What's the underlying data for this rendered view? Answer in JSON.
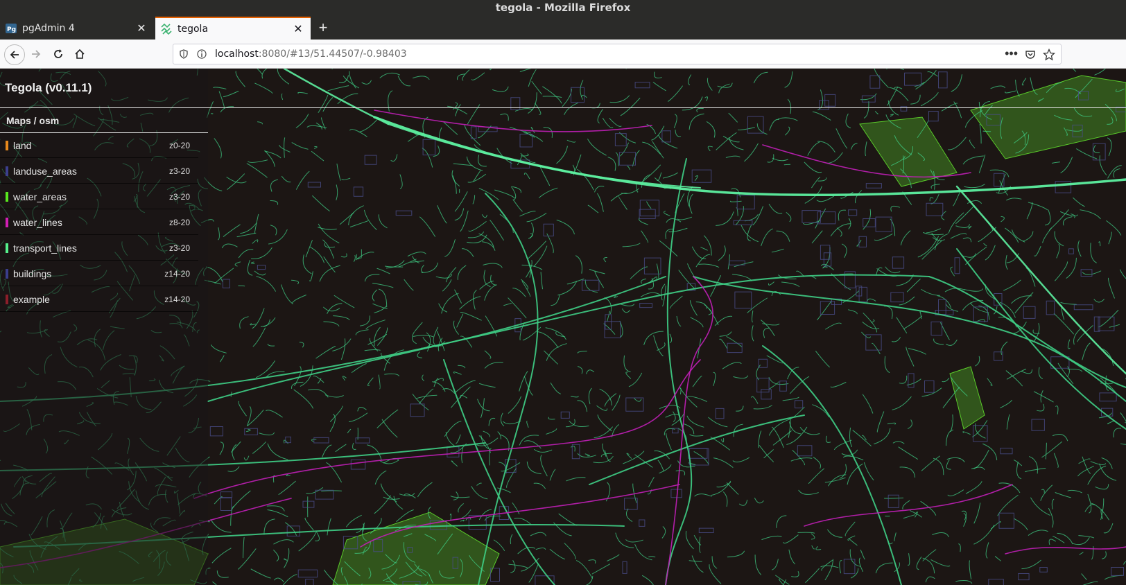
{
  "window": {
    "title": "tegola - Mozilla Firefox"
  },
  "tabs": [
    {
      "label": "pgAdmin 4",
      "icon": "pgadmin-icon",
      "active": false
    },
    {
      "label": "tegola",
      "icon": "tegola-icon",
      "active": true
    }
  ],
  "navbar": {
    "url_host": "localhost",
    "url_rest": ":8080/#13/51.44507/-0.98403"
  },
  "app": {
    "title": "Tegola (v0.11.1)"
  },
  "maps": {
    "title": "Maps / osm",
    "layers": [
      {
        "name": "land",
        "zoom": "z0-20",
        "color": "#e8891c"
      },
      {
        "name": "landuse_areas",
        "zoom": "z3-20",
        "color": "#3c3f8e"
      },
      {
        "name": "water_areas",
        "zoom": "z3-20",
        "color": "#58e61e"
      },
      {
        "name": "water_lines",
        "zoom": "z8-20",
        "color": "#d21fb4"
      },
      {
        "name": "transport_lines",
        "zoom": "z3-20",
        "color": "#55f08c"
      },
      {
        "name": "buildings",
        "zoom": "z14-20",
        "color": "#3a3e8c"
      },
      {
        "name": "example",
        "zoom": "z14-20",
        "color": "#8c1e2a"
      }
    ]
  },
  "colors": {
    "roads": "#3fcf86",
    "motorway": "#5df0a0",
    "water_lines": "#c21fb8",
    "water_areas": "#5acb2a",
    "map_bg": "#1c1614"
  }
}
